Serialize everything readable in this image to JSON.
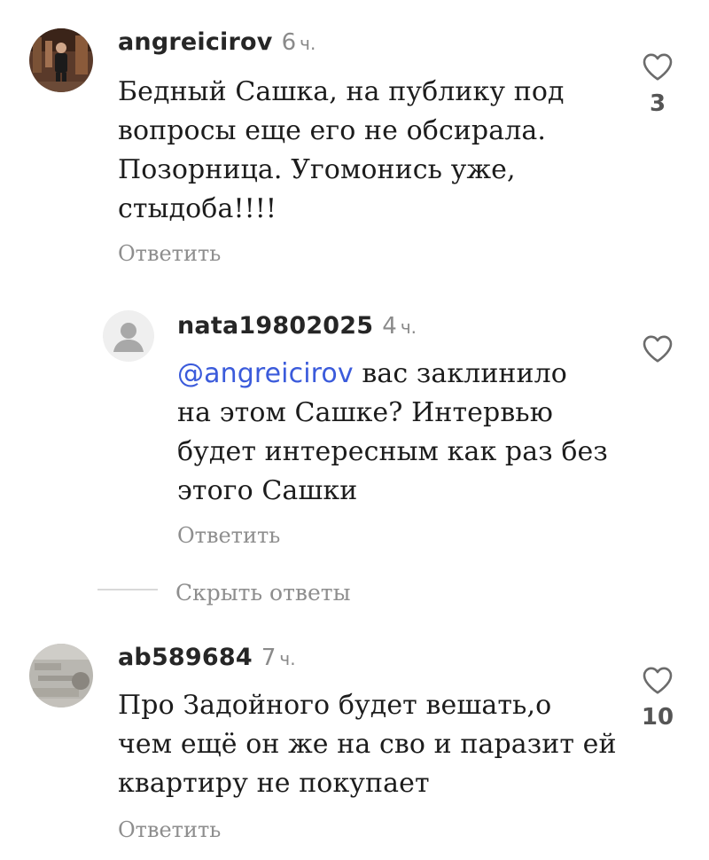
{
  "comments": [
    {
      "username": "angreicirov",
      "time_value": "6",
      "time_unit": "ч.",
      "text_lines": [
        "Бедный Сашка, на публику под",
        "вопросы еще его не обсирала.",
        "Позорница. Угомонись уже,",
        "стыдоба!!!!"
      ],
      "reply_label": "Ответить",
      "like_count": "3"
    },
    {
      "username": "nata19802025",
      "time_value": "4",
      "time_unit": "ч.",
      "mention": "@angreicirov",
      "first_line_rest": " вас заклинило",
      "text_lines": [
        "на этом Сашке? Интервью",
        "будет интересным как раз без",
        "этого Сашки"
      ],
      "reply_label": "Ответить"
    },
    {
      "username": "ab589684",
      "time_value": "7",
      "time_unit": "ч.",
      "text_lines": [
        "Про Задойного будет вешать,о",
        "чем ещё он же на сво и паразит ей",
        "квартиру не покупает"
      ],
      "reply_label": "Ответить",
      "like_count": "10"
    }
  ],
  "hide_replies_label": "Скрыть ответы",
  "icons": {
    "like": "heart-outline-icon",
    "default_avatar": "default-avatar-icon"
  },
  "colors": {
    "mention": "#3b5bdb",
    "muted": "#8e8e8e",
    "text": "#1c1c1c"
  }
}
